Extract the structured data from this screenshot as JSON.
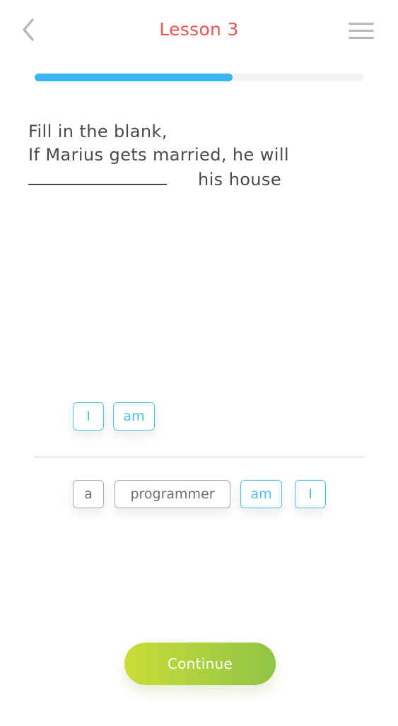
{
  "header": {
    "title": "Lesson 3"
  },
  "progress": {
    "fraction": 0.6
  },
  "prompt": {
    "line1": "Fill in the blank,",
    "line2": "If Marius gets married, he will",
    "line3_after_blank": "his house"
  },
  "selected_words": [
    "I",
    "am"
  ],
  "word_bank": [
    "a",
    "programmer",
    "am",
    "I"
  ],
  "continue_label": "Continue",
  "colors": {
    "title": "#ef5350",
    "progress": "#3bb7ef",
    "selected_chip": "#4fc0ee",
    "unselected_chip_border": "#a9a9a9",
    "continue_start": "#c9dd38",
    "continue_end": "#8fc445"
  },
  "icons": {
    "back": "chevron-left-icon",
    "menu": "hamburger-menu-icon"
  }
}
